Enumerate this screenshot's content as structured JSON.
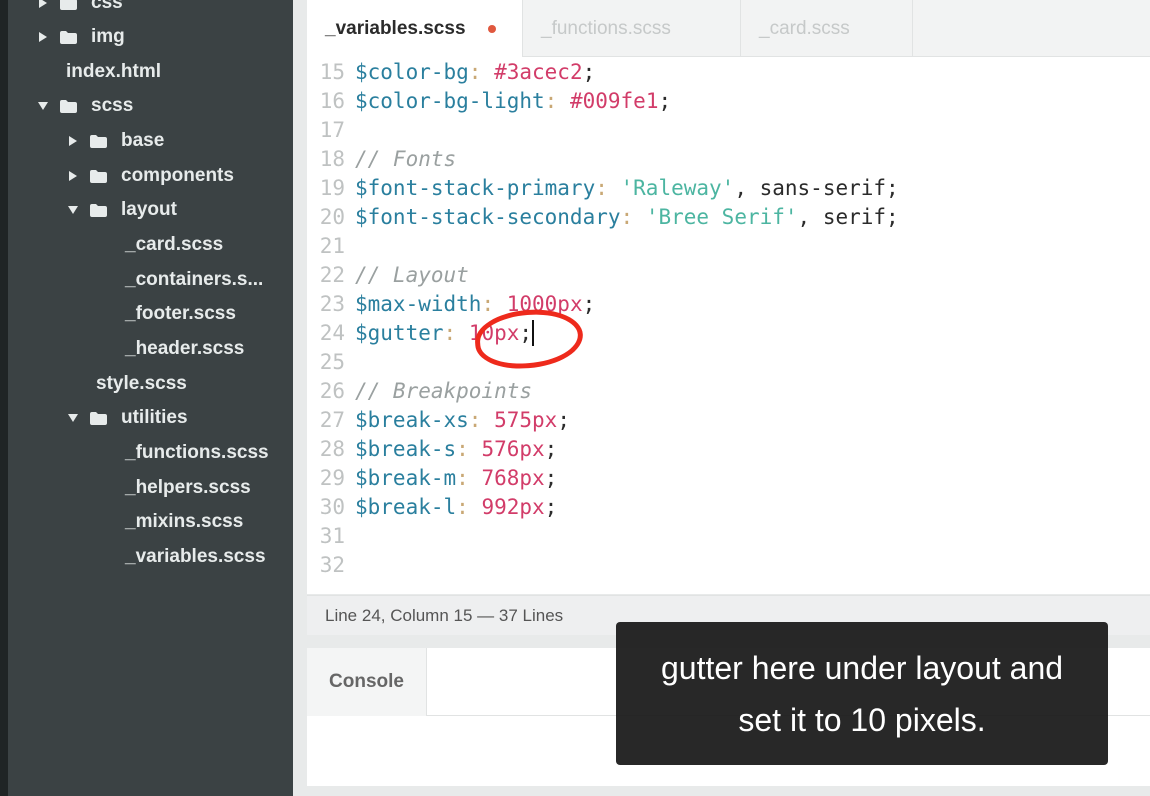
{
  "sidebar": {
    "items": [
      {
        "label": "css",
        "type": "folder",
        "expanded": false
      },
      {
        "label": "img",
        "type": "folder",
        "expanded": false
      },
      {
        "label": "index.html",
        "type": "file"
      },
      {
        "label": "scss",
        "type": "folder",
        "expanded": true
      },
      {
        "label": "base",
        "type": "folder",
        "expanded": false
      },
      {
        "label": "components",
        "type": "folder",
        "expanded": false
      },
      {
        "label": "layout",
        "type": "folder",
        "expanded": true
      },
      {
        "label": "_card.scss",
        "type": "file"
      },
      {
        "label": "_containers.s...",
        "type": "file"
      },
      {
        "label": "_footer.scss",
        "type": "file"
      },
      {
        "label": "_header.scss",
        "type": "file"
      },
      {
        "label": "style.scss",
        "type": "file"
      },
      {
        "label": "utilities",
        "type": "folder",
        "expanded": true
      },
      {
        "label": "_functions.scss",
        "type": "file"
      },
      {
        "label": "_helpers.scss",
        "type": "file"
      },
      {
        "label": "_mixins.scss",
        "type": "file"
      },
      {
        "label": "_variables.scss",
        "type": "file"
      }
    ]
  },
  "tabs": [
    {
      "label": "_variables.scss",
      "active": true,
      "modified": true
    },
    {
      "label": "_functions.scss",
      "active": false
    },
    {
      "label": "_card.scss",
      "active": false
    }
  ],
  "code": {
    "lines": [
      {
        "n": "15",
        "var": "$color-bg",
        "colon": ":",
        "val": " #3acec2",
        "semi": ";"
      },
      {
        "n": "16",
        "var": "$color-bg-light",
        "colon": ":",
        "val": " #009fe1",
        "semi": ";"
      },
      {
        "n": "17"
      },
      {
        "n": "18",
        "comment": "// Fonts"
      },
      {
        "n": "19",
        "var": "$font-stack-primary",
        "colon": ":",
        "str": " 'Raleway'",
        "rest": ", sans-serif;"
      },
      {
        "n": "20",
        "var": "$font-stack-secondary",
        "colon": ":",
        "str": " 'Bree Serif'",
        "rest": ", serif;"
      },
      {
        "n": "21"
      },
      {
        "n": "22",
        "comment": "// Layout"
      },
      {
        "n": "23",
        "var": "$max-width",
        "colon": ":",
        "val": " 1000px",
        "semi": ";"
      },
      {
        "n": "24",
        "var": "$gutter",
        "colon": ":",
        "val": " 10px",
        "semi": ";"
      },
      {
        "n": "25"
      },
      {
        "n": "26",
        "comment": "// Breakpoints"
      },
      {
        "n": "27",
        "var": "$break-xs",
        "colon": ":",
        "val": " 575px",
        "semi": ";"
      },
      {
        "n": "28",
        "var": "$break-s",
        "colon": ":",
        "val": " 576px",
        "semi": ";"
      },
      {
        "n": "29",
        "var": "$break-m",
        "colon": ":",
        "val": " 768px",
        "semi": ";"
      },
      {
        "n": "30",
        "var": "$break-l",
        "colon": ":",
        "val": " 992px",
        "semi": ";"
      },
      {
        "n": "31"
      },
      {
        "n": "32"
      }
    ]
  },
  "status": {
    "text": "Line 24, Column 15 — 37 Lines"
  },
  "console": {
    "tab_label": "Console"
  },
  "caption": {
    "line1": "gutter here under layout and",
    "line2": "set it to 10 pixels."
  },
  "colors": {
    "annotation": "#ee2a1c",
    "modified_dot": "#e0583e"
  }
}
